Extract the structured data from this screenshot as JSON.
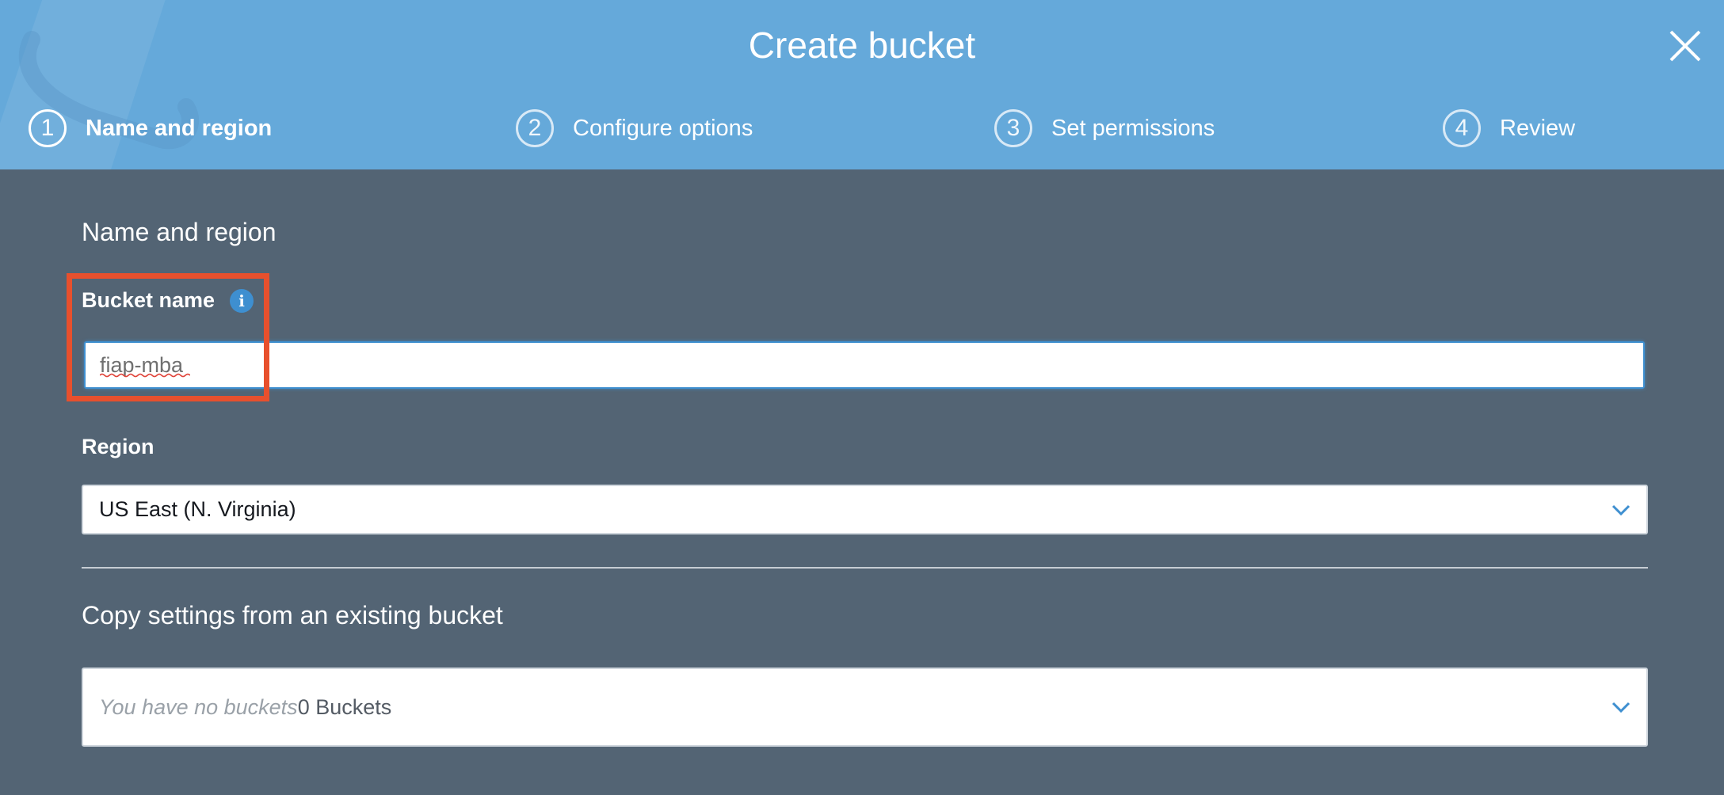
{
  "dialog": {
    "title": "Create bucket",
    "close_icon": "close-icon"
  },
  "steps": [
    {
      "number": "1",
      "label": "Name and region",
      "active": true
    },
    {
      "number": "2",
      "label": "Configure options",
      "active": false
    },
    {
      "number": "3",
      "label": "Set permissions",
      "active": false
    },
    {
      "number": "4",
      "label": "Review",
      "active": false
    }
  ],
  "form": {
    "section_title": "Name and region",
    "bucket_name": {
      "label": "Bucket name",
      "info_icon": "i",
      "value": "fiap-mba"
    },
    "region": {
      "label": "Region",
      "selected": "US East (N. Virginia)"
    },
    "copy_settings": {
      "title": "Copy settings from an existing bucket",
      "placeholder": "You have no buckets",
      "count": "0 Buckets"
    }
  },
  "colors": {
    "header_bg": "#65a9da",
    "body_bg": "#536474",
    "accent": "#3e8fd0",
    "highlight": "#e8502d"
  }
}
